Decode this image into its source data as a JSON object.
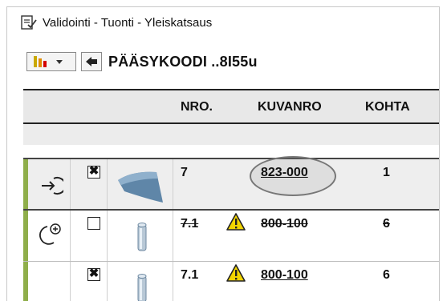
{
  "window": {
    "title": "Validointi - Tuonti - Yleiskatsaus",
    "title_icon": "document-check-icon"
  },
  "toolbar": {
    "chart_button_icon": "bar-chart-dropdown-icon",
    "back_button_icon": "return-arrow-icon",
    "title": "PÄÄSYKOODI ..8I55u"
  },
  "table": {
    "columns": [
      "NRO.",
      "KUVANRO",
      "KOHTA"
    ],
    "rows": [
      {
        "icon": "arrow-into-circle-icon",
        "checked": "✖",
        "thumbnail": "curved-panel-thumbnail",
        "nro": "7",
        "kuvanro": "823-000",
        "kohta": "1",
        "warning": false,
        "strike": false,
        "highlighted": true
      },
      {
        "icon": "add-rotate-icon",
        "checked": "",
        "thumbnail": "cylinder-thumbnail",
        "nro": "7.1",
        "kuvanro": "800-100",
        "kohta": "6",
        "warning": true,
        "strike": true,
        "highlighted": false
      },
      {
        "icon": "",
        "checked": "✖",
        "thumbnail": "cylinder-thumbnail",
        "nro": "7.1",
        "kuvanro": "800-100",
        "kohta": "6",
        "warning": true,
        "strike": false,
        "highlighted": false
      }
    ]
  },
  "colors": {
    "status_bar": "#8fae4a",
    "warning": "#f2d400",
    "header_bg": "#e8e8e8"
  }
}
